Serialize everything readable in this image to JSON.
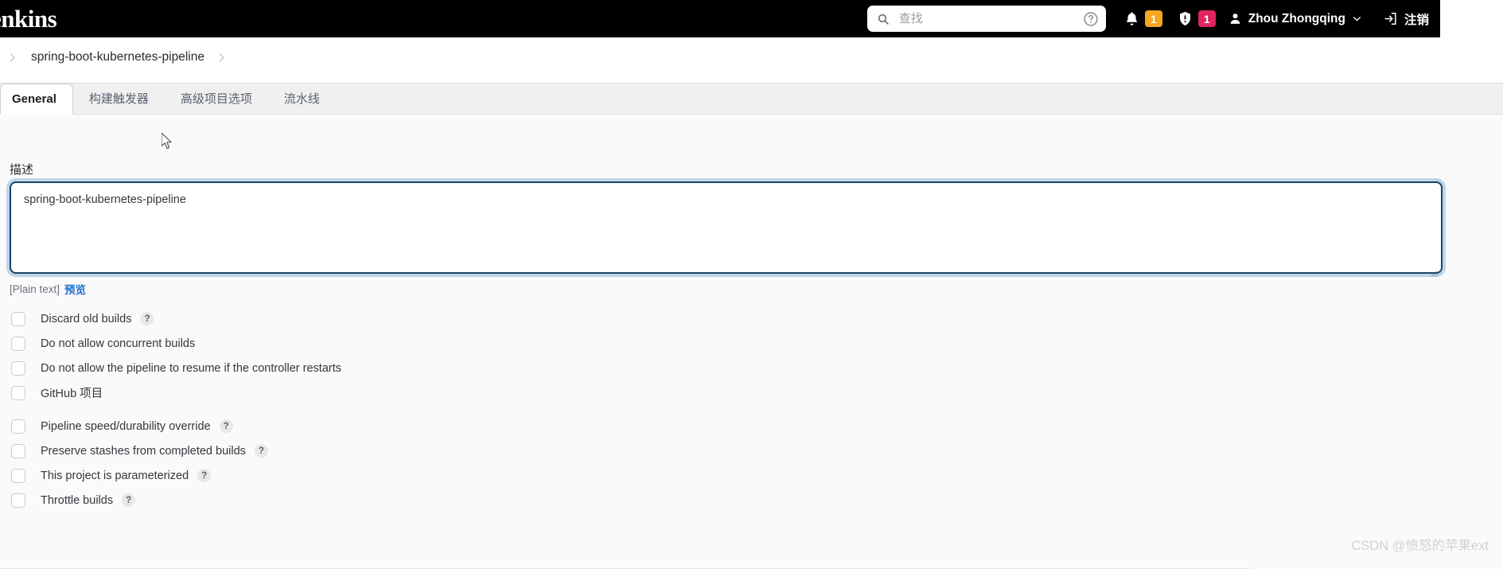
{
  "header": {
    "brand": "enkins",
    "search": {
      "placeholder": "查找",
      "value": "",
      "icon": "search-icon",
      "help_icon": "help-circle-icon"
    },
    "notifications": {
      "bell_icon": "bell-icon",
      "bell_count": "1",
      "bell_badge_color": "#f5a623",
      "security_icon": "shield-exclamation-icon",
      "security_count": "1",
      "security_badge_color": "#e0245e"
    },
    "user": {
      "icon": "user-icon",
      "name": "Zhou Zhongqing",
      "chevron_icon": "chevron-down-icon"
    },
    "logout": {
      "icon": "logout-icon",
      "label": "注销"
    }
  },
  "breadcrumb": {
    "leading_icon": "chevron-right-icon",
    "item": "spring-boot-kubernetes-pipeline",
    "trailing_icon": "chevron-right-icon"
  },
  "tabs": [
    {
      "label": "General",
      "active": true
    },
    {
      "label": "构建触发器",
      "active": false
    },
    {
      "label": "高级项目选项",
      "active": false
    },
    {
      "label": "流水线",
      "active": false
    }
  ],
  "main": {
    "description": {
      "label": "描述",
      "value": "spring-boot-kubernetes-pipeline",
      "markup_note": "[Plain text]",
      "preview_link": "预览"
    },
    "options": [
      {
        "label": "Discard old builds",
        "checked": false,
        "help": "?"
      },
      {
        "label": "Do not allow concurrent builds",
        "checked": false,
        "help": ""
      },
      {
        "label": "Do not allow the pipeline to resume if the controller restarts",
        "checked": false,
        "help": ""
      },
      {
        "label": "GitHub 项目",
        "checked": false,
        "help": ""
      },
      {
        "label": "Pipeline speed/durability override",
        "checked": false,
        "help": "?"
      },
      {
        "label": "Preserve stashes from completed builds",
        "checked": false,
        "help": "?"
      },
      {
        "label": "This project is parameterized",
        "checked": false,
        "help": "?"
      },
      {
        "label": "Throttle builds",
        "checked": false,
        "help": "?"
      }
    ]
  },
  "watermark": "CSDN @愤怒的苹果ext"
}
